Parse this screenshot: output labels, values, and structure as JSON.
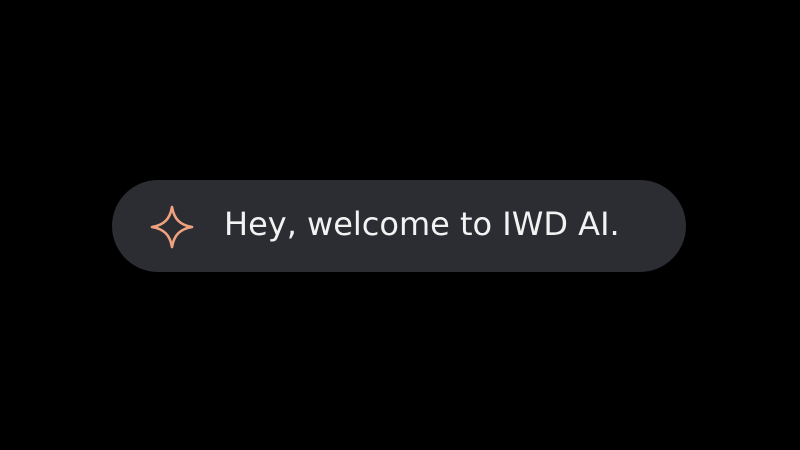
{
  "welcome_banner": {
    "icon": "sparkle-icon",
    "message": "Hey, welcome to IWD AI."
  },
  "colors": {
    "background": "#000000",
    "pill": "#2b2d33",
    "text": "#f2f2f2",
    "icon_accent": "#f0a27f"
  }
}
